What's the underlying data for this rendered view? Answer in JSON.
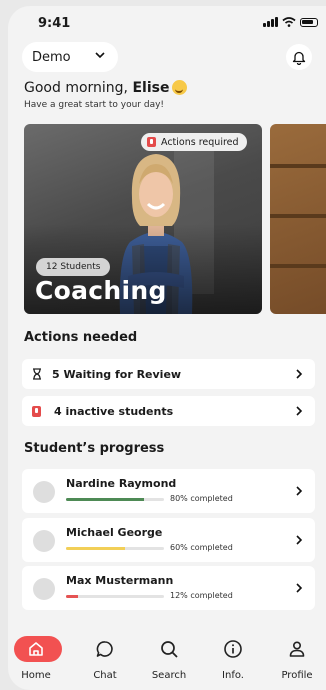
{
  "status": {
    "time": "9:41"
  },
  "header": {
    "dropdown_value": "Demo",
    "icons": {
      "dropdown": "chevron-down-icon",
      "notifications": "bell-icon"
    }
  },
  "greeting": {
    "prefix": "Good morning, ",
    "name": "Elise",
    "subtitle": "Have a great start to your day!"
  },
  "cards": [
    {
      "badge": "Actions required",
      "students": "12 Students",
      "title": "Coaching"
    }
  ],
  "actions": {
    "heading": "Actions needed",
    "items": [
      {
        "label": "5 Waiting for Review",
        "icon": "hourglass-icon"
      },
      {
        "label": "4 inactive students",
        "icon": "alert-icon"
      }
    ]
  },
  "progress": {
    "heading": "Student’s progress",
    "students": [
      {
        "name": "Nardine Raymond",
        "percent_label": "80% completed",
        "percent": 80,
        "color": "#4e8a55"
      },
      {
        "name": "Michael George",
        "percent_label": "60% completed",
        "percent": 60,
        "color": "#f2cf57"
      },
      {
        "name": "Max Mustermann",
        "percent_label": "12% completed",
        "percent": 12,
        "color": "#e55353"
      }
    ]
  },
  "nav": [
    {
      "label": "Home",
      "icon": "home-icon",
      "active": true
    },
    {
      "label": "Chat",
      "icon": "chat-icon"
    },
    {
      "label": "Search",
      "icon": "search-icon"
    },
    {
      "label": "Info.",
      "icon": "info-icon"
    },
    {
      "label": "Profile",
      "icon": "profile-icon"
    }
  ],
  "colors": {
    "accent": "#f25151",
    "background": "#f3f3f3"
  }
}
